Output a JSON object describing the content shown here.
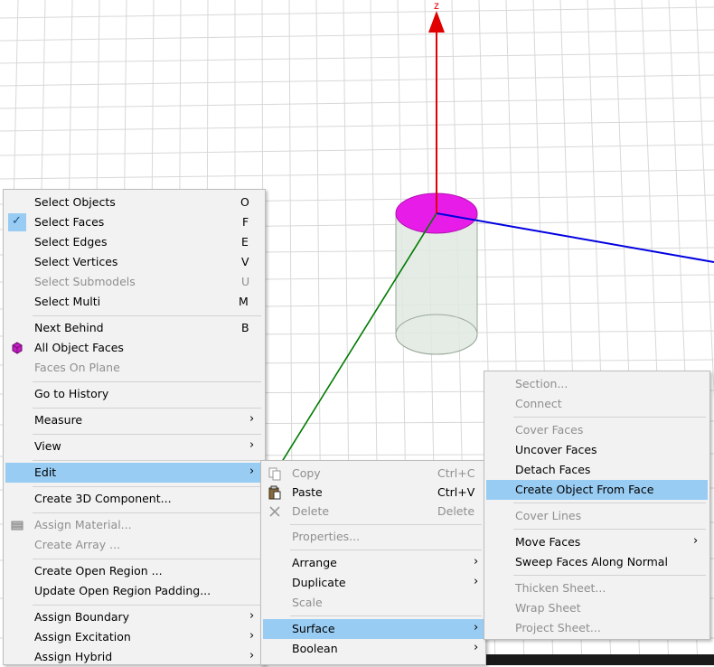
{
  "viewport": {
    "axis_z_label": "z",
    "colors": {
      "z_axis": "#e00000",
      "x_axis": "#0000e0",
      "y_axis": "#007a00",
      "face_selected": "#e81ce8",
      "cylinder_body": "#d9e6dc",
      "grid": "#d6d6d6"
    }
  },
  "main_menu": {
    "items": [
      {
        "label": "Select Objects",
        "shortcut": "O"
      },
      {
        "label": "Select Faces",
        "shortcut": "F",
        "checked": true
      },
      {
        "label": "Select Edges",
        "shortcut": "E"
      },
      {
        "label": "Select Vertices",
        "shortcut": "V"
      },
      {
        "label": "Select Submodels",
        "shortcut": "U",
        "disabled": true
      },
      {
        "label": "Select Multi",
        "shortcut": "M"
      },
      {
        "label": "Next Behind",
        "shortcut": "B"
      },
      {
        "label": "All Object Faces",
        "icon": "cube-icon"
      },
      {
        "label": "Faces On Plane",
        "disabled": true
      },
      {
        "label": "Go to History"
      },
      {
        "label": "Measure",
        "submenu": true
      },
      {
        "label": "View",
        "submenu": true
      },
      {
        "label": "Edit",
        "submenu": true,
        "highlighted": true
      },
      {
        "label": "Create 3D Component..."
      },
      {
        "label": "Assign Material...",
        "disabled": true,
        "icon": "material-icon"
      },
      {
        "label": "Create Array ...",
        "disabled": true
      },
      {
        "label": "Create Open Region ..."
      },
      {
        "label": "Update Open Region Padding..."
      },
      {
        "label": "Assign Boundary",
        "submenu": true
      },
      {
        "label": "Assign Excitation",
        "submenu": true
      },
      {
        "label": "Assign Hybrid",
        "submenu": true
      }
    ]
  },
  "edit_menu": {
    "items": [
      {
        "label": "Copy",
        "shortcut": "Ctrl+C",
        "disabled": true,
        "icon": "copy-icon"
      },
      {
        "label": "Paste",
        "shortcut": "Ctrl+V",
        "icon": "paste-icon"
      },
      {
        "label": "Delete",
        "shortcut": "Delete",
        "disabled": true,
        "icon": "delete-icon"
      },
      {
        "label": "Properties...",
        "disabled": true
      },
      {
        "label": "Arrange",
        "submenu": true
      },
      {
        "label": "Duplicate",
        "submenu": true
      },
      {
        "label": "Scale",
        "disabled": true
      },
      {
        "label": "Surface",
        "submenu": true,
        "highlighted": true
      },
      {
        "label": "Boolean",
        "submenu": true
      }
    ]
  },
  "surface_menu": {
    "items": [
      {
        "label": "Section...",
        "disabled": true
      },
      {
        "label": "Connect",
        "disabled": true
      },
      {
        "label": "Cover Faces",
        "disabled": true
      },
      {
        "label": "Uncover Faces"
      },
      {
        "label": "Detach Faces"
      },
      {
        "label": "Create Object From Face",
        "highlighted": true
      },
      {
        "label": "Cover Lines",
        "disabled": true
      },
      {
        "label": "Move Faces",
        "submenu": true
      },
      {
        "label": "Sweep Faces Along Normal"
      },
      {
        "label": "Thicken Sheet...",
        "disabled": true
      },
      {
        "label": "Wrap Sheet",
        "disabled": true
      },
      {
        "label": "Project Sheet...",
        "disabled": true
      }
    ]
  },
  "submenu_arrow": "›",
  "checkmark": "✓"
}
